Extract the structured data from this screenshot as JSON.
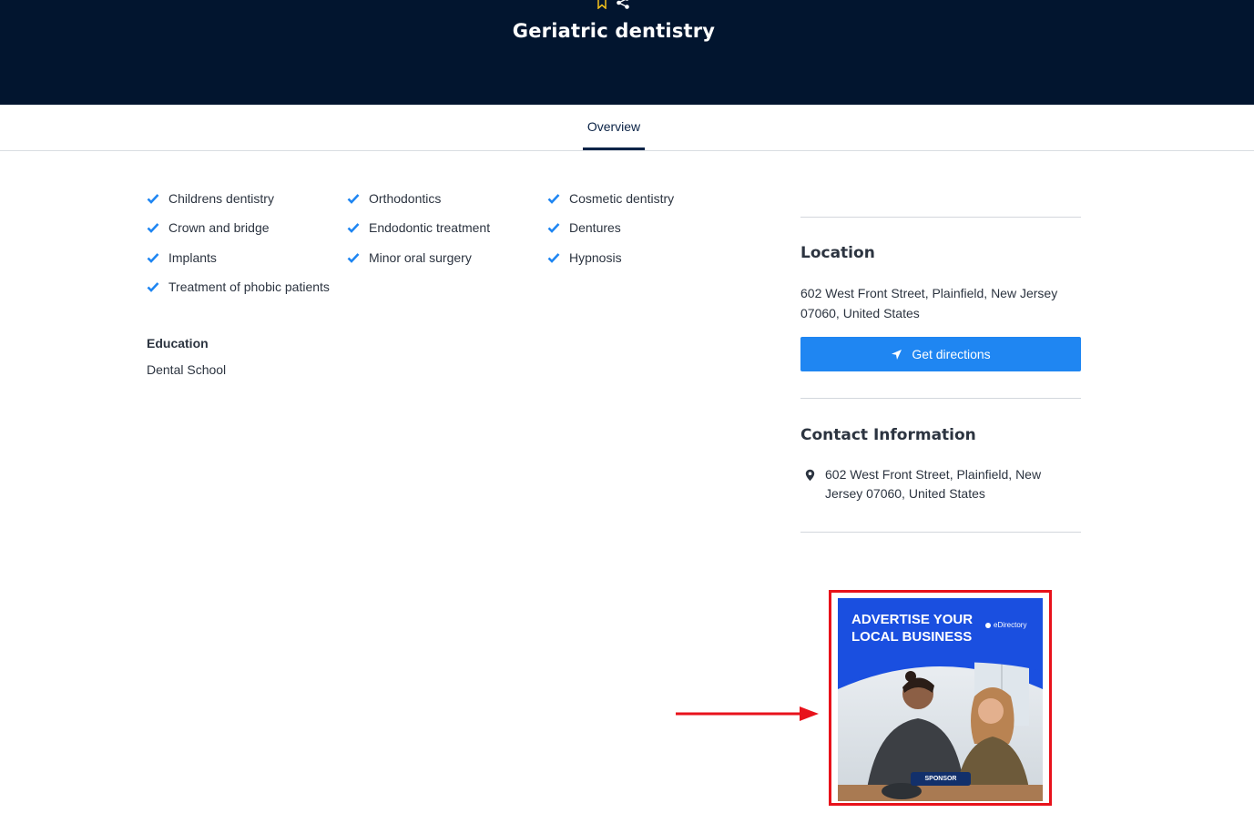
{
  "header": {
    "title": "Geriatric dentistry",
    "actions": [
      "bookmark-icon",
      "share-icon"
    ],
    "title_color": "#ffffff",
    "background": "#02152f"
  },
  "tabs": [
    {
      "label": "Overview",
      "active": true
    }
  ],
  "features": [
    "Childrens dentistry",
    "Orthodontics",
    "Cosmetic dentistry",
    "Crown and bridge",
    "Endodontic treatment",
    "Dentures",
    "Implants",
    "Minor oral surgery",
    "Hypnosis",
    "Treatment of phobic patients"
  ],
  "education": {
    "label": "Education",
    "value": "Dental School"
  },
  "location": {
    "heading": "Location",
    "address": "602 West Front Street, Plainfield, New Jersey 07060, United States",
    "directions_label": "Get directions"
  },
  "contact": {
    "heading": "Contact Information",
    "address": "602 West Front Street, Plainfield, New Jersey 07060, United States"
  },
  "sponsor": {
    "headline": "ADVERTISE YOUR LOCAL BUSINESS",
    "brand": "eDirectory",
    "badge": "SPONSOR",
    "highlight_color": "#e8121b"
  },
  "colors": {
    "accent": "#1f86f2",
    "check": "#1f86f2",
    "text": "#2c3440"
  }
}
